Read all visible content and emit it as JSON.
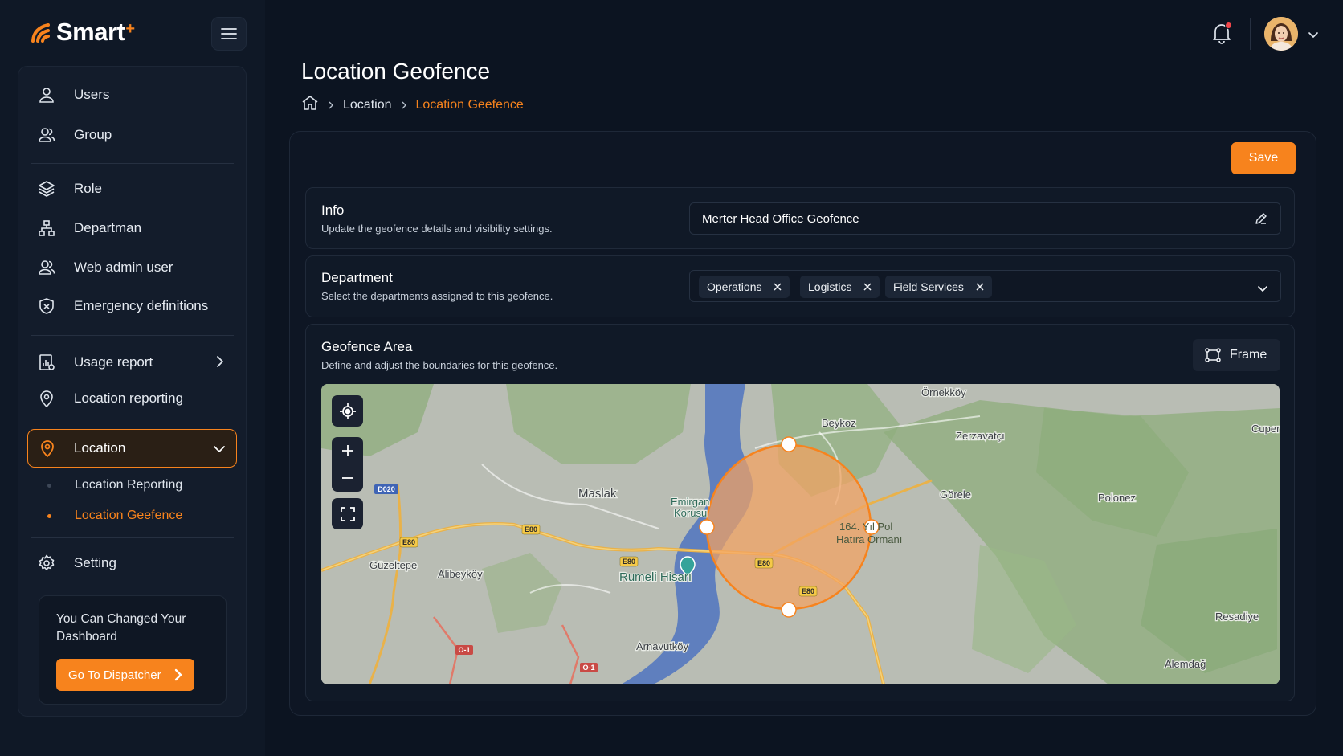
{
  "brand": {
    "name": "Smart",
    "superscript": "+"
  },
  "sidebar": {
    "items": [
      {
        "label": "Users",
        "icon": "user-icon"
      },
      {
        "label": "Group",
        "icon": "group-icon"
      },
      {
        "label": "Role",
        "icon": "layers-icon"
      },
      {
        "label": "Departman",
        "icon": "org-chart-icon"
      },
      {
        "label": "Web admin user",
        "icon": "admin-user-icon"
      },
      {
        "label": "Emergency definitions",
        "icon": "shield-icon"
      },
      {
        "label": "Usage report",
        "icon": "report-icon"
      },
      {
        "label": "Location reporting",
        "icon": "pin-icon"
      }
    ],
    "active": {
      "label": "Location",
      "icon": "pin-icon"
    },
    "subitems": [
      {
        "label": "Location Reporting"
      },
      {
        "label": "Location Geefence"
      }
    ],
    "setting": {
      "label": "Setting",
      "icon": "gear-icon"
    },
    "promo": {
      "text": "You Can Changed Your Dashboard",
      "button": "Go To Dispatcher"
    }
  },
  "header": {
    "notification_icon": "bell-icon",
    "avatar": "user-avatar"
  },
  "page": {
    "title": "Location Geofence",
    "breadcrumb": {
      "home_icon": "home-icon",
      "parent": "Location",
      "current": "Location Geefence"
    }
  },
  "toolbar": {
    "save_label": "Save"
  },
  "info": {
    "title": "Info",
    "subtitle": "Update the geofence details and visibility settings.",
    "value": "Merter Head Office Geofence"
  },
  "department": {
    "title": "Department",
    "subtitle": "Select the departments assigned to this geofence.",
    "chips": [
      "Operations",
      "Logistics",
      "Field Services"
    ]
  },
  "geofence": {
    "title": "Geofence Area",
    "subtitle": "Define and adjust the boundaries for this geofence.",
    "frame_label": "Frame"
  },
  "map": {
    "labels": {
      "ornekkoy": "Örnekköy",
      "beykoz": "Beykoz",
      "zerzavatci": "Zerzavatçı",
      "cuper": "Cuper",
      "maslak": "Maslak",
      "emirgan": "Emirgan",
      "korusu": "Korusu",
      "gorele": "Görele",
      "polonez": "Polonez",
      "poligon": "164. Yıl Pol",
      "hatira": "Hatıra Ormanı",
      "guzeltepe": "Güzeltepe",
      "alibeykoy": "Alibeyköy",
      "rumeli": "Rumeli Hisarı",
      "resadiye": "Resadiye",
      "arnavutkoy": "Arnavutköy",
      "alemdag": "Alemdağ"
    },
    "shields": {
      "d020": "D020",
      "e80": "E80",
      "o1": "O-1"
    },
    "colors": {
      "accent": "#f7831d",
      "geofence_fill": "#f4a261",
      "water": "#5f7fbe",
      "forest": "#8fb07e"
    }
  }
}
